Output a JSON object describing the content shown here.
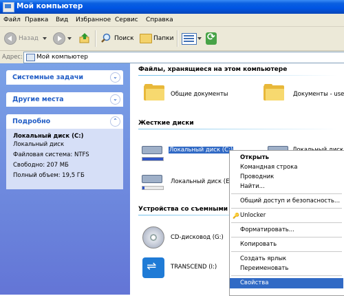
{
  "window": {
    "title": "Мой компьютер"
  },
  "menubar": [
    "Файл",
    "Правка",
    "Вид",
    "Избранное",
    "Сервис",
    "Справка"
  ],
  "toolbar": {
    "back": "Назад",
    "search": "Поиск",
    "folders": "Папки"
  },
  "address": {
    "label": "Адрес:",
    "value": "Мой компьютер"
  },
  "leftpane": {
    "system_tasks": "Системные задачи",
    "other_places": "Другие места",
    "details": {
      "title": "Подробно",
      "name": "Локальный диск (C:)",
      "type": "Локальный диск",
      "fs": "Файловая система: NTFS",
      "free": "Свободно: 207 МБ",
      "total": "Полный объем: 19,5 ГБ"
    }
  },
  "content": {
    "section_files": "Файлы, хранящиеся на этом компьютере",
    "shared_docs": "Общие документы",
    "user_docs": "Документы - user",
    "section_drives": "Жесткие диски",
    "drive_c": "Локальный диск (C:)",
    "drive_d": "Локальный диск (D:)",
    "drive_e": "Локальный диск (E:)",
    "section_removable": "Устройства со съемными но",
    "cd_drive": "CD-дисковод (G:)",
    "usb_drive": "TRANSCEND (I:)",
    "drive_c_used": 0.99,
    "drive_e_used": 0.1
  },
  "context_menu": {
    "open": "Открыть",
    "cmd": "Командная строка",
    "explorer": "Проводник",
    "find": "Найти...",
    "sharing": "Общий доступ и безопасность...",
    "unlocker": "Unlocker",
    "format": "Форматировать...",
    "copy": "Копировать",
    "shortcut": "Создать ярлык",
    "rename": "Переименовать",
    "properties": "Свойства"
  },
  "colors": {
    "titlebar": "#0054e3",
    "selection": "#316ac5",
    "leftpane": "#6f8fe0"
  }
}
